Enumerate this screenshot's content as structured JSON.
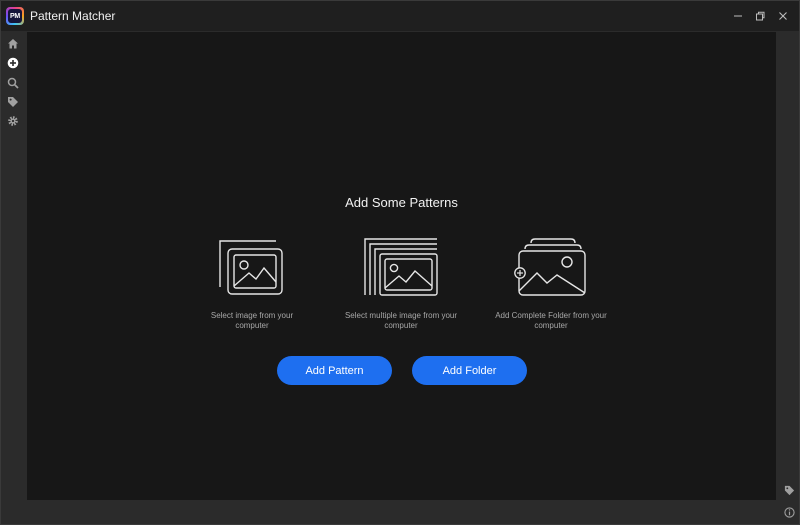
{
  "app": {
    "title": "Pattern Matcher",
    "logo_text": "PM",
    "accent_color": "#1e6ff0"
  },
  "window_controls": [
    "minimize-icon",
    "maximize-icon",
    "close-icon"
  ],
  "sidebar": {
    "items": [
      {
        "icon": "home-icon"
      },
      {
        "icon": "add-circle-icon"
      },
      {
        "icon": "search-icon"
      },
      {
        "icon": "tag-icon"
      },
      {
        "icon": "gear-icon"
      }
    ]
  },
  "main": {
    "heading": "Add Some Patterns",
    "options": [
      {
        "icon": "single-image-icon",
        "caption": "Select image from your computer"
      },
      {
        "icon": "multiple-images-icon",
        "caption": "Select multiple image from your computer"
      },
      {
        "icon": "folder-images-icon",
        "caption": "Add Complete Folder from your computer"
      }
    ],
    "buttons": {
      "add_pattern": "Add Pattern",
      "add_folder": "Add Folder"
    }
  },
  "right_panel": {
    "icons": [
      "tag-icon",
      "info-icon"
    ]
  }
}
